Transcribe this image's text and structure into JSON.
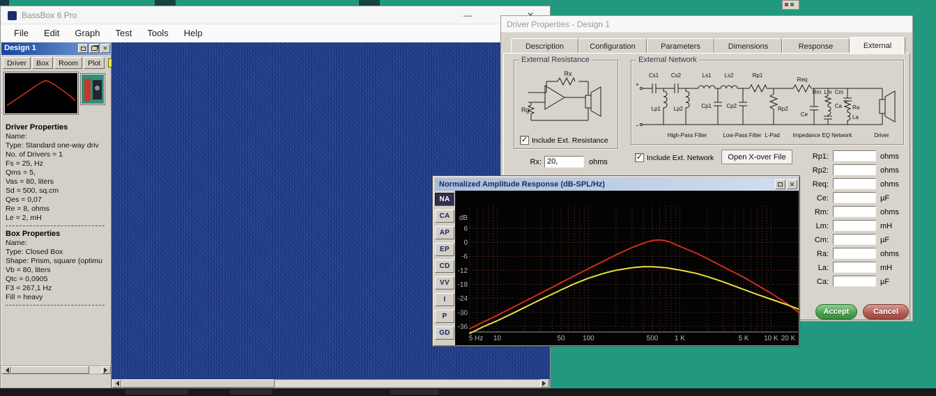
{
  "colors": {
    "desktop_bg": "#22997f",
    "mdi_bg": "#24418c",
    "swatch_yellow": "#f0ee30",
    "accept_green": "#47a24b",
    "cancel_red": "#b35b52",
    "curve_red": "#d22b20",
    "curve_yellow": "#e8e23c"
  },
  "glyphs": {
    "close": "✕",
    "minimize": "—",
    "check": "✓"
  },
  "main_window": {
    "title": "BassBox 6 Pro",
    "menu": [
      "File",
      "Edit",
      "Graph",
      "Test",
      "Tools",
      "Help"
    ]
  },
  "design_panel": {
    "title": "Design 1",
    "tabs": [
      "Driver",
      "Box",
      "Room",
      "Plot"
    ],
    "driver_heading": "Driver Properties",
    "driver_lines": [
      "Name:",
      "Type: Standard one-way driv",
      "No. of Drivers = 1",
      "Fs = 25, Hz",
      "Qms = 5,",
      "Vas = 80, liters",
      "Sd = 500, sq.cm",
      "Qes = 0,07",
      "Re = 8, ohms",
      "Le = 2, mH"
    ],
    "box_heading": "Box Properties",
    "box_lines": [
      "Name:",
      "Type: Closed Box",
      "Shape: Prism, square (optimu",
      "Vb = 80, liters",
      "Qtc = 0,0905",
      "F3 = 267,1 Hz",
      "Fill = heavy"
    ]
  },
  "driver_dialog": {
    "title": "Driver Properties - Design 1",
    "tabs": [
      "Description",
      "Configuration",
      "Parameters",
      "Dimensions",
      "Response",
      "External"
    ],
    "active_tab": "External",
    "resistance": {
      "group": "External Resistance",
      "rg": "Rg",
      "rx": "Rx",
      "checkbox": "Include Ext. Resistance",
      "rx_label": "Rx:",
      "rx_value": "20,",
      "rx_unit": "ohms"
    },
    "network": {
      "group": "External Network",
      "checkbox": "Include Ext. Network",
      "open_button": "Open X-over File",
      "plus": "+",
      "minus": "−",
      "cs1": "Cs1",
      "cs2": "Cs2",
      "ls1": "Ls1",
      "ls2": "Ls2",
      "rp1": "Rp1",
      "lp1": "Lp1",
      "lp2": "Lp2",
      "cp1": "Cp1",
      "cp2": "Cp2",
      "rp2": "Rp2",
      "req": "Req",
      "rm": "Rm",
      "lm": "Lm",
      "cm": "Cm",
      "ce": "Ce",
      "ca": "Ca",
      "ra": "Ra",
      "la": "La",
      "sections": [
        "High-Pass Filter",
        "Low-Pass Filter",
        "L-Pad",
        "Impedance EQ Network",
        "Driver"
      ]
    },
    "fields": [
      {
        "label": "Rp1:",
        "value": "",
        "unit": "ohms"
      },
      {
        "label": "Rp2:",
        "value": "",
        "unit": "ohms"
      },
      {
        "label": "Req:",
        "value": "",
        "unit": "ohms"
      },
      {
        "label": "Ce:",
        "value": "",
        "unit": "µF"
      },
      {
        "label": "Rm:",
        "value": "",
        "unit": "ohms"
      },
      {
        "label": "Lm:",
        "value": "",
        "unit": "mH"
      },
      {
        "label": "Cm:",
        "value": "",
        "unit": "µF"
      },
      {
        "label": "Ra:",
        "value": "",
        "unit": "ohms"
      },
      {
        "label": "La:",
        "value": "",
        "unit": "mH"
      },
      {
        "label": "Ca:",
        "value": "",
        "unit": "µF"
      }
    ],
    "accept": "Accept",
    "cancel": "Cancel"
  },
  "graph_window": {
    "title": "Normalized Amplitude Response (dB-SPL/Hz)",
    "buttons": [
      "NA",
      "CA",
      "AP",
      "EP",
      "CD",
      "VV",
      "I",
      "P",
      "GD"
    ],
    "active_button": "NA"
  },
  "chart_data": {
    "type": "line",
    "title": "Normalized Amplitude Response (dB-SPL/Hz)",
    "plot_bg": "#030303",
    "grid_color": "#7c392b",
    "label_color": "#b8b8b8",
    "x_axis": {
      "scale": "log",
      "min": 5,
      "max": 20000,
      "ticks": [
        {
          "f": 5,
          "label": "5 Hz"
        },
        {
          "f": 10,
          "label": "10"
        },
        {
          "f": 50,
          "label": "50"
        },
        {
          "f": 100,
          "label": "100"
        },
        {
          "f": 500,
          "label": "500"
        },
        {
          "f": 1000,
          "label": "1 K"
        },
        {
          "f": 5000,
          "label": "5 K"
        },
        {
          "f": 10000,
          "label": "10 K"
        },
        {
          "f": 20000,
          "label": "20 K"
        }
      ]
    },
    "y_axis": {
      "unit": "dB",
      "ticks": [
        6,
        0,
        -6,
        -12,
        -18,
        -24,
        -30,
        -36
      ],
      "plot_top_db": 21,
      "plot_bottom_db": -39
    },
    "series": [
      {
        "name": "normalized-response-red",
        "color": "#d22b20",
        "points": [
          [
            5,
            -37
          ],
          [
            7,
            -34.2
          ],
          [
            10,
            -31.3
          ],
          [
            15,
            -27.8
          ],
          [
            20,
            -25.3
          ],
          [
            30,
            -21.8
          ],
          [
            40,
            -19.3
          ],
          [
            50,
            -17.3
          ],
          [
            70,
            -14.4
          ],
          [
            100,
            -11.3
          ],
          [
            150,
            -7.9
          ],
          [
            200,
            -5.4
          ],
          [
            300,
            -2.3
          ],
          [
            400,
            -0.4
          ],
          [
            500,
            0.7
          ],
          [
            600,
            1.0
          ],
          [
            700,
            0.6
          ],
          [
            800,
            -0.1
          ],
          [
            1000,
            -1.8
          ],
          [
            1500,
            -4.6
          ],
          [
            2000,
            -7
          ],
          [
            3000,
            -10.6
          ],
          [
            5000,
            -15
          ],
          [
            7000,
            -18.3
          ],
          [
            10000,
            -21.8
          ],
          [
            15000,
            -26.3
          ],
          [
            20000,
            -30
          ]
        ]
      },
      {
        "name": "normalized-response-yellow",
        "color": "#e8e23c",
        "points": [
          [
            5,
            -39
          ],
          [
            7,
            -36.2
          ],
          [
            10,
            -33.6
          ],
          [
            15,
            -30.3
          ],
          [
            20,
            -27.9
          ],
          [
            30,
            -24.5
          ],
          [
            40,
            -22.2
          ],
          [
            50,
            -20.4
          ],
          [
            70,
            -17.8
          ],
          [
            100,
            -15.4
          ],
          [
            150,
            -13.2
          ],
          [
            200,
            -12
          ],
          [
            300,
            -10.9
          ],
          [
            400,
            -10.5
          ],
          [
            500,
            -10.5
          ],
          [
            700,
            -10.9
          ],
          [
            1000,
            -11.9
          ],
          [
            1500,
            -13.3
          ],
          [
            2000,
            -14.7
          ],
          [
            3000,
            -17
          ],
          [
            5000,
            -20.2
          ],
          [
            7000,
            -22.3
          ],
          [
            10000,
            -24.4
          ],
          [
            15000,
            -26.8
          ],
          [
            20000,
            -28.6
          ]
        ]
      }
    ]
  }
}
